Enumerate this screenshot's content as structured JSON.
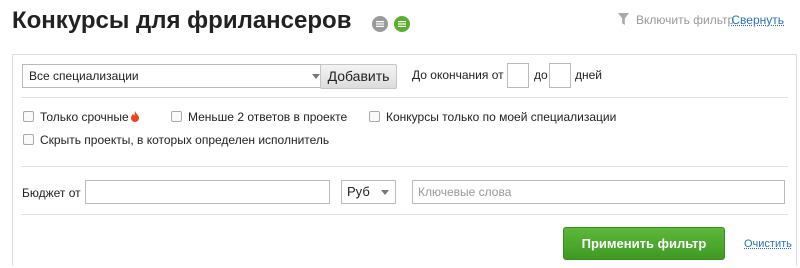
{
  "header": {
    "title": "Конкурсы для фрилансеров",
    "title_icons": [
      "list-icon",
      "list-icon"
    ],
    "filter_toggle_label": "Включить фильтр",
    "collapse_label": "Свернуть"
  },
  "filters": {
    "specialization": {
      "selected": "Все специализации"
    },
    "add_button": "Добавить",
    "deadline": {
      "from_label": "До окончания от",
      "to_label": "до",
      "days_label": "дней",
      "from_value": "",
      "to_value": ""
    },
    "checkboxes": {
      "urgent": "Только срочные",
      "few_answers": "Меньше 2 ответов в проекте",
      "my_spec": "Конкурсы только по моей специализации",
      "hide_assigned": "Скрыть проекты, в которых определен исполнитель"
    },
    "budget": {
      "label": "Бюджет от",
      "value": ""
    },
    "currency": {
      "selected": "Руб"
    },
    "keywords": {
      "placeholder": "Ключевые слова"
    },
    "apply_button": "Применить фильтр",
    "clear_link": "Очистить"
  },
  "colors": {
    "accent_green": "#4caf2e",
    "link_blue": "#2a72b8",
    "fire_red": "#e8461c"
  }
}
